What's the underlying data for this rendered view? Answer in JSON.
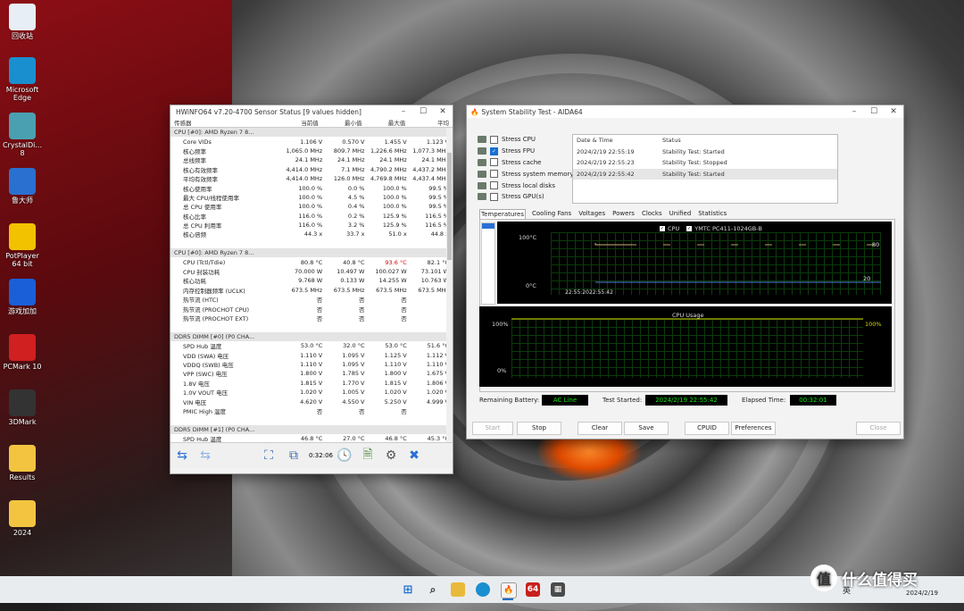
{
  "desktop": {
    "icons": [
      {
        "label": "回收站",
        "icon": "recycle-bin-icon"
      },
      {
        "label": "Microsoft Edge",
        "icon": "edge-icon"
      },
      {
        "label": "CrystalDi... 8",
        "icon": "crystaldisk-icon"
      },
      {
        "label": "鲁大师",
        "icon": "ludashi-icon"
      },
      {
        "label": "PotPlayer 64 bit",
        "icon": "potplayer-icon"
      },
      {
        "label": "游戏加加",
        "icon": "gameplus-icon"
      },
      {
        "label": "PCMark 10",
        "icon": "pcmark-icon"
      },
      {
        "label": "3DMark",
        "icon": "3dmark-icon"
      },
      {
        "label": "Results",
        "icon": "folder-icon"
      },
      {
        "label": "2024",
        "icon": "folder-icon"
      }
    ]
  },
  "hwinfo": {
    "title": "HWiNFO64 v7.20-4700 Sensor Status [9 values hidden]",
    "columns": [
      "传感器",
      "当前值",
      "最小值",
      "最大值",
      "平均"
    ],
    "rows": [
      {
        "type": "group",
        "name": "CPU [#0]: AMD Ryzen 7 8..."
      },
      {
        "name": "Core VIDs",
        "v": [
          "1.106 V",
          "0.570 V",
          "1.455 V",
          "1.123 V"
        ]
      },
      {
        "name": "核心频率",
        "v": [
          "1,065.0 MHz",
          "809.7 MHz",
          "1,226.6 MHz",
          "1,077.3 MHz"
        ]
      },
      {
        "name": "总线频率",
        "v": [
          "24.1 MHz",
          "24.1 MHz",
          "24.1 MHz",
          "24.1 MHz"
        ]
      },
      {
        "name": "核心有效频率",
        "v": [
          "4,414.0 MHz",
          "7.1 MHz",
          "4,790.2 MHz",
          "4,437.2 MHz"
        ]
      },
      {
        "name": "平均有效频率",
        "v": [
          "4,414.0 MHz",
          "126.0 MHz",
          "4,769.8 MHz",
          "4,437.4 MHz"
        ]
      },
      {
        "name": "核心使用率",
        "v": [
          "100.0 %",
          "0.0 %",
          "100.0 %",
          "99.5 %"
        ]
      },
      {
        "name": "最大 CPU/线程使用率",
        "v": [
          "100.0 %",
          "4.5 %",
          "100.0 %",
          "99.5 %"
        ]
      },
      {
        "name": "总 CPU 使用率",
        "v": [
          "100.0 %",
          "0.4 %",
          "100.0 %",
          "99.5 %"
        ]
      },
      {
        "name": "核心比率",
        "v": [
          "116.0 %",
          "0.2 %",
          "125.9 %",
          "116.5 %"
        ]
      },
      {
        "name": "总 CPU 利用率",
        "v": [
          "116.0 %",
          "3.2 %",
          "125.9 %",
          "116.5 %"
        ]
      },
      {
        "name": "核心倍频",
        "v": [
          "44.3 x",
          "33.7 x",
          "51.0 x",
          "44.8 x"
        ]
      },
      {
        "type": "blank"
      },
      {
        "type": "group",
        "name": "CPU [#0]: AMD Ryzen 7 8..."
      },
      {
        "name": "CPU (Tctl/Tdie)",
        "v": [
          "80.8 °C",
          "40.8 °C",
          "93.6 °C",
          "82.1 °C"
        ],
        "hot": 2
      },
      {
        "name": "CPU 封装功耗",
        "v": [
          "70.000 W",
          "10.497 W",
          "100.027 W",
          "73.101 W"
        ]
      },
      {
        "name": "核心功耗",
        "v": [
          "9.768 W",
          "0.133 W",
          "14.255 W",
          "10.763 W"
        ]
      },
      {
        "name": "内存控制器频率 (UCLK)",
        "v": [
          "673.5 MHz",
          "673.5 MHz",
          "673.5 MHz",
          "673.5 MHz"
        ]
      },
      {
        "name": "热节流 (HTC)",
        "v": [
          "否",
          "否",
          "否",
          ""
        ]
      },
      {
        "name": "热节流 (PROCHOT CPU)",
        "v": [
          "否",
          "否",
          "否",
          ""
        ]
      },
      {
        "name": "热节流 (PROCHOT EXT)",
        "v": [
          "否",
          "否",
          "否",
          ""
        ]
      },
      {
        "type": "blank"
      },
      {
        "type": "group",
        "name": "DDR5 DIMM [#0] (P0 CHA..."
      },
      {
        "name": "SPD Hub 温度",
        "v": [
          "53.0 °C",
          "32.0 °C",
          "53.0 °C",
          "51.6 °C"
        ]
      },
      {
        "name": "VDD (SWA) 电压",
        "v": [
          "1.110 V",
          "1.095 V",
          "1.125 V",
          "1.112 V"
        ]
      },
      {
        "name": "VDDQ (SWB) 电压",
        "v": [
          "1.110 V",
          "1.095 V",
          "1.110 V",
          "1.110 V"
        ]
      },
      {
        "name": "VPP (SWC) 电压",
        "v": [
          "1.800 V",
          "1.785 V",
          "1.800 V",
          "1.675 V"
        ]
      },
      {
        "name": "1.8V 电压",
        "v": [
          "1.815 V",
          "1.770 V",
          "1.815 V",
          "1.806 V"
        ]
      },
      {
        "name": "1.0V VOUT 电压",
        "v": [
          "1.020 V",
          "1.005 V",
          "1.020 V",
          "1.020 V"
        ]
      },
      {
        "name": "VIN 电压",
        "v": [
          "4.620 V",
          "4.550 V",
          "5.250 V",
          "4.999 V"
        ]
      },
      {
        "name": "PMIC High 温度",
        "v": [
          "否",
          "否",
          "否",
          ""
        ]
      },
      {
        "type": "blank"
      },
      {
        "type": "group",
        "name": "DDR5 DIMM [#1] (P0 CHA..."
      },
      {
        "name": "SPD Hub 温度",
        "v": [
          "46.8 °C",
          "27.0 °C",
          "46.8 °C",
          "45.3 °C"
        ]
      }
    ],
    "timer": "0:32:06"
  },
  "aida": {
    "title": "System Stability Test - AIDA64",
    "stress": [
      {
        "label": "Stress CPU",
        "checked": false
      },
      {
        "label": "Stress FPU",
        "checked": true
      },
      {
        "label": "Stress cache",
        "checked": false
      },
      {
        "label": "Stress system memory",
        "checked": false
      },
      {
        "label": "Stress local disks",
        "checked": false
      },
      {
        "label": "Stress GPU(s)",
        "checked": false
      }
    ],
    "log_headers": [
      "Date & Time",
      "Status"
    ],
    "log": [
      {
        "date": "2024/2/19 22:55:19",
        "status": "Stability Test: Started"
      },
      {
        "date": "2024/2/19 22:55:23",
        "status": "Stability Test: Stopped"
      },
      {
        "date": "2024/2/19 22:55:42",
        "status": "Stability Test: Started"
      }
    ],
    "tabs": [
      "Temperatures",
      "Cooling Fans",
      "Voltages",
      "Powers",
      "Clocks",
      "Unified",
      "Statistics"
    ],
    "temp_graph": {
      "legend": [
        "CPU",
        "YMTC PC411-1024GB-B"
      ],
      "y_top": "100°C",
      "y_bottom": "0°C",
      "time_label": "22:55:2022:55:42",
      "right_values": [
        "80",
        "20"
      ],
      "cpu_temp": 80,
      "disk_temp": 20
    },
    "usage_graph": {
      "title": "CPU Usage",
      "y_top": "100%",
      "y_bottom": "0%",
      "right_value": "100%",
      "value": 100
    },
    "battery_label": "Remaining Battery:",
    "battery_value": "AC Line",
    "started_label": "Test Started:",
    "started_value": "2024/2/19 22:55:42",
    "elapsed_label": "Elapsed Time:",
    "elapsed_value": "00:32:01",
    "buttons": [
      "Start",
      "Stop",
      "Clear",
      "Save",
      "CPUID",
      "Preferences",
      "Close"
    ]
  },
  "taskbar": {
    "ime": "英",
    "date": "2024/2/19",
    "watermark": "什么值得买"
  }
}
